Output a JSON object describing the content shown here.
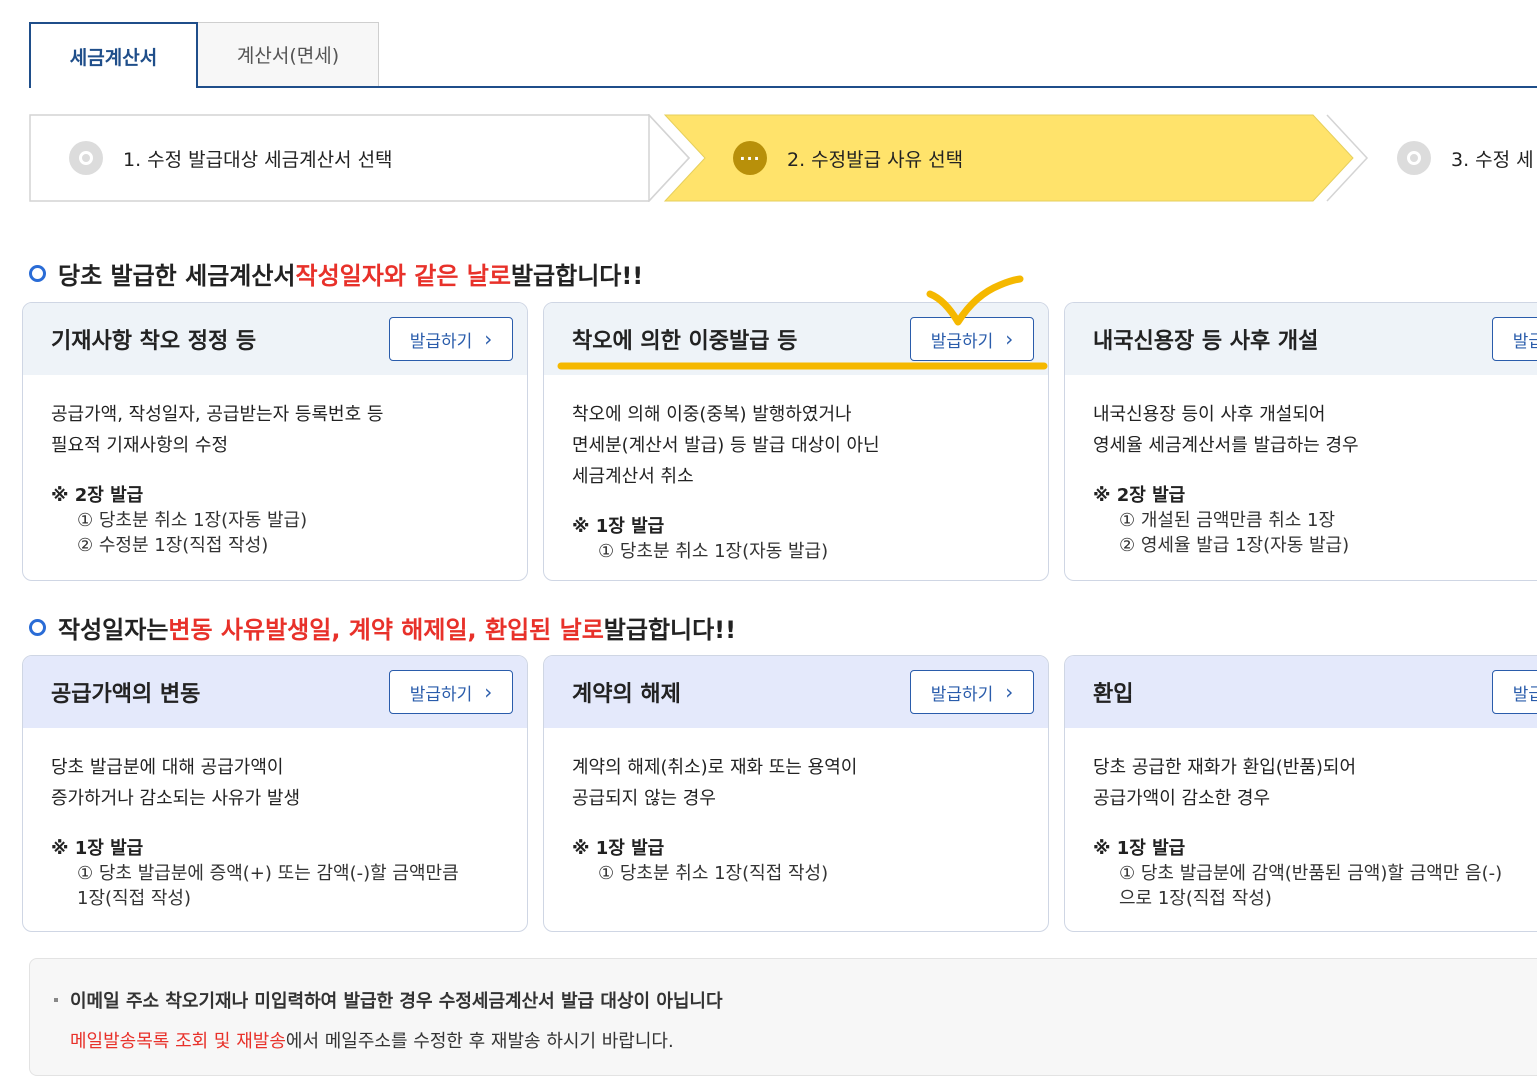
{
  "tabs": [
    {
      "label": "세금계산서",
      "active": true
    },
    {
      "label": "계산서(면세)",
      "active": false
    }
  ],
  "steps": [
    {
      "label": "1. 수정 발급대상 세금계산서 선택",
      "state": "done"
    },
    {
      "label": "2. 수정발급 사유 선택",
      "state": "current",
      "marker": "···"
    },
    {
      "label": "3. 수정 세",
      "state": "pending"
    }
  ],
  "section1": {
    "text_a": "당초 발급한 세금계산서 ",
    "highlight": "작성일자와 같은 날로",
    "text_b": " 발급합니다!!"
  },
  "section2": {
    "text_a": "작성일자는 ",
    "highlight": "변동 사유발생일, 계약 해제일, 환입된 날로",
    "text_b": " 발급합니다!!"
  },
  "issue_label": "발급하기",
  "cards_row1": [
    {
      "title": "기재사항 착오 정정 등",
      "desc": [
        "공급가액, 작성일자, 공급받는자 등록번호 등",
        "필요적 기재사항의 수정"
      ],
      "note_lead": "※ 2장 발급",
      "note_items": [
        "① 당초분 취소 1장(자동 발급)",
        "② 수정분 1장(직접 작성)"
      ]
    },
    {
      "title": "착오에 의한 이중발급 등",
      "desc": [
        "착오에 의해 이중(중복) 발행하였거나",
        "면세분(계산서 발급) 등 발급 대상이 아닌",
        "세금계산서 취소"
      ],
      "note_lead": "※ 1장 발급",
      "note_items": [
        "① 당초분 취소 1장(자동 발급)"
      ]
    },
    {
      "title": "내국신용장 등 사후 개설",
      "desc": [
        "내국신용장 등이 사후 개설되어",
        "영세율 세금계산서를 발급하는 경우"
      ],
      "note_lead": "※ 2장 발급",
      "note_items": [
        "① 개설된 금액만큼 취소 1장",
        "② 영세율 발급 1장(자동 발급)"
      ]
    }
  ],
  "cards_row2": [
    {
      "title": "공급가액의 변동",
      "desc": [
        "당초 발급분에 대해 공급가액이",
        "증가하거나 감소되는 사유가 발생"
      ],
      "note_lead": "※ 1장 발급",
      "note_items": [
        "① 당초 발급분에 증액(+) 또는 감액(-)할 금액만큼",
        "1장(직접 작성)"
      ]
    },
    {
      "title": "계약의 해제",
      "desc": [
        "계약의 해제(취소)로 재화 또는 용역이",
        "공급되지 않는 경우"
      ],
      "note_lead": "※ 1장 발급",
      "note_items": [
        "① 당초분 취소 1장(직접 작성)"
      ]
    },
    {
      "title": "환입",
      "desc": [
        "당초 공급한 재화가 환입(반품)되어",
        "공급가액이 감소한 경우"
      ],
      "note_lead": "※ 1장 발급",
      "note_items": [
        "① 당초 발급분에 감액(반품된 금액)할 금액만 음(-)",
        "으로 1장(직접 작성)"
      ]
    }
  ],
  "info": {
    "line1": "이메일 주소 착오기재나 미입력하여 발급한 경우 수정세금계산서 발급 대상이 아닙니다",
    "link": "메일발송목록 조회 및 재발송",
    "line2_rest": "에서 메일주소를 수정한 후 재발송 하시기 바랍니다."
  },
  "colors": {
    "primary": "#1f4e8a",
    "accent_red": "#e8312a",
    "step_current": "#ffe36b",
    "annotation": "#f5b800"
  }
}
